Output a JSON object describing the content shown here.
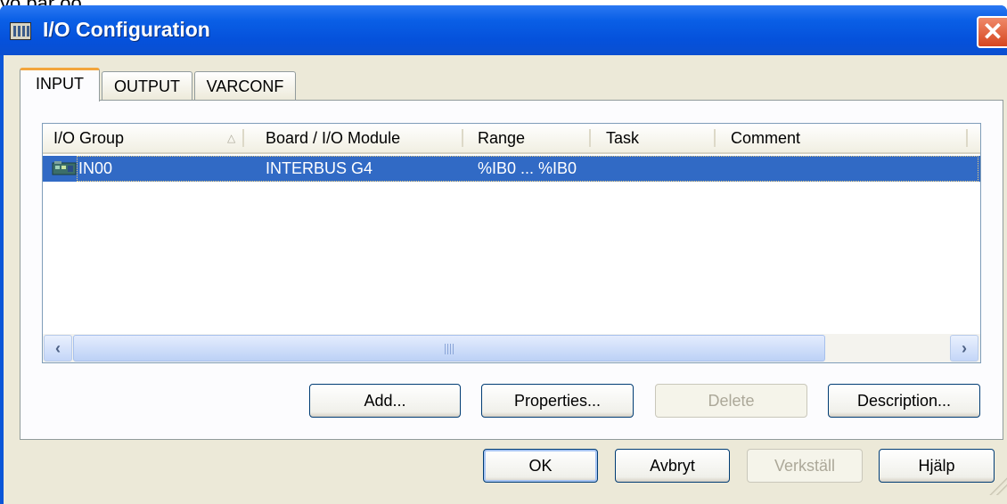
{
  "window": {
    "title": "I/O Configuration",
    "cutoff_text": "yo par oo"
  },
  "tabs": [
    {
      "label": "INPUT",
      "active": true
    },
    {
      "label": "OUTPUT",
      "active": false
    },
    {
      "label": "VARCONF",
      "active": false
    }
  ],
  "list": {
    "columns": [
      "I/O Group",
      "Board / I/O Module",
      "Range",
      "Task",
      "Comment"
    ],
    "sort_indicator": "△",
    "rows": [
      {
        "group": "IN00",
        "module": "INTERBUS G4",
        "range": "%IB0 ... %IB0",
        "task": "",
        "comment": "",
        "selected": true,
        "icon": "io-module-icon"
      }
    ]
  },
  "panel_buttons": [
    {
      "label": "Add...",
      "enabled": true
    },
    {
      "label": "Properties...",
      "enabled": true
    },
    {
      "label": "Delete",
      "enabled": false
    },
    {
      "label": "Description...",
      "enabled": true
    }
  ],
  "dialog_buttons": [
    {
      "label": "OK",
      "enabled": true,
      "default": true
    },
    {
      "label": "Avbryt",
      "enabled": true
    },
    {
      "label": "Verkställ",
      "enabled": false
    },
    {
      "label": "Hjälp",
      "enabled": true
    }
  ],
  "colors": {
    "titlebar": "#0a5fe6",
    "selection": "#316ac5",
    "face": "#ece9d8",
    "close": "#d6461f"
  }
}
